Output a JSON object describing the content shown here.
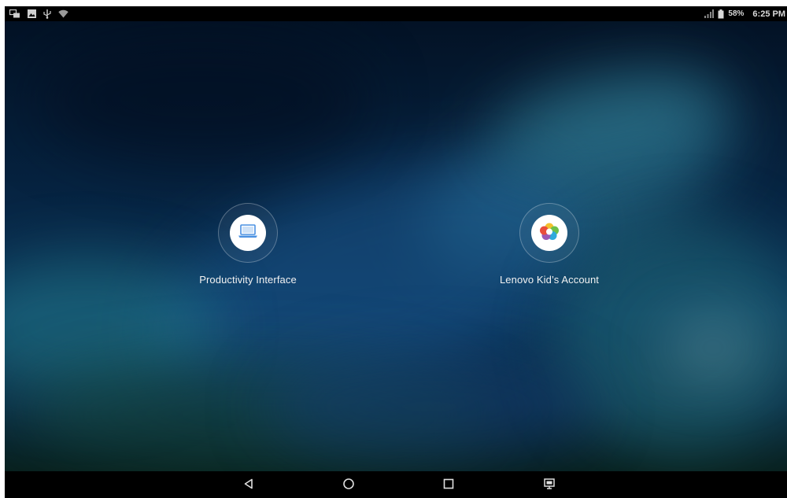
{
  "status_bar": {
    "left_icons": [
      "screen-mirror-icon",
      "image-notification-icon",
      "usb-icon",
      "wifi-icon"
    ],
    "battery_percent": "58%",
    "time": "6:25 PM"
  },
  "options": [
    {
      "label": "Productivity Interface",
      "icon": "laptop-icon"
    },
    {
      "label": "Lenovo Kid’s Account",
      "icon": "kids-flower-icon"
    }
  ],
  "nav_bar": {
    "buttons": [
      "back-icon",
      "home-icon",
      "recents-icon",
      "screen-cast-icon"
    ]
  },
  "colors": {
    "accent_laptop": "#4a90e2",
    "status_text": "#d9d9d9",
    "label_text": "#f2f2f2"
  }
}
